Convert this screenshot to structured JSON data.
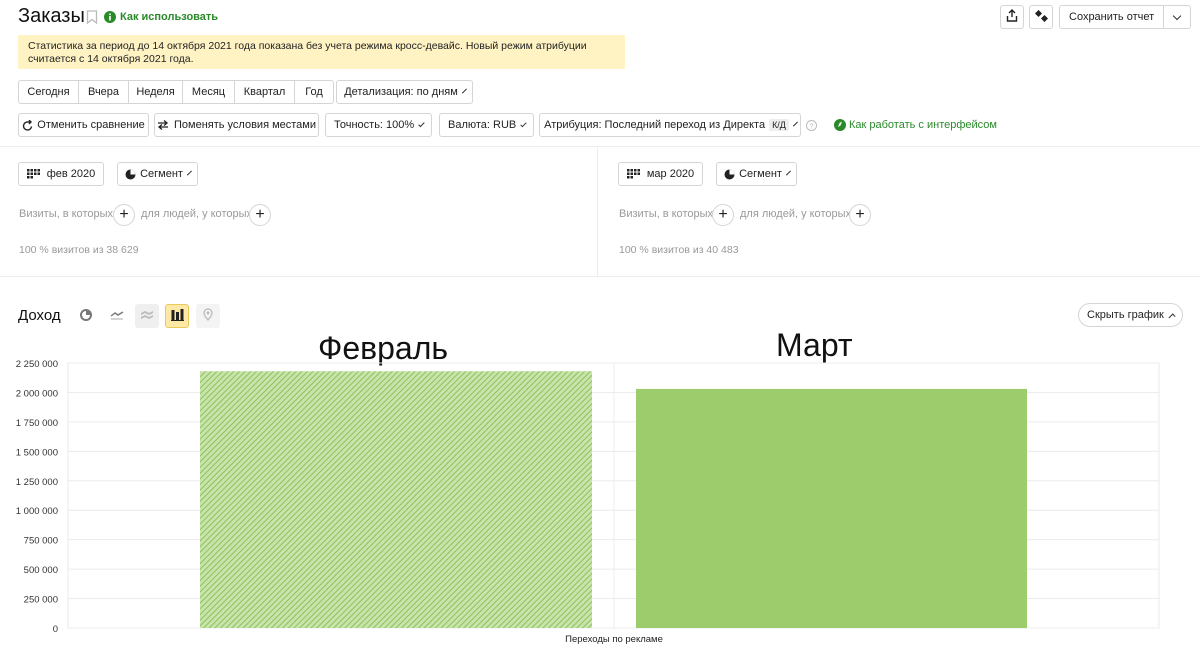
{
  "header": {
    "title": "Заказы",
    "how_to_use": "Как использовать",
    "save_report": "Сохранить отчет"
  },
  "notice": {
    "line1": "Статистика за период до 14 октября 2021 года показана без учета режима кросс-девайс. Новый режим атрибуции",
    "line2": "считается с 14 октября 2021 года."
  },
  "periods": [
    "Сегодня",
    "Вчера",
    "Неделя",
    "Месяц",
    "Квартал",
    "Год"
  ],
  "detail": "Детализация: по дням",
  "toolbar": {
    "cancel_compare": "Отменить сравнение",
    "swap_conditions": "Поменять условия местами",
    "accuracy": "Точность: 100%",
    "currency": "Валюта: RUB",
    "attribution": "Атрибуция: Последний переход из Директа",
    "attribution_badge": "К/Д",
    "how_to_work": "Как работать с интерфейсом"
  },
  "left_segment": {
    "date": "фев 2020",
    "segment": "Сегмент",
    "visits_label": "Визиты, в которых",
    "people_label": "для людей, у которых",
    "summary": "100 % визитов из 38 629"
  },
  "right_segment": {
    "date": "мар 2020",
    "segment": "Сегмент",
    "visits_label": "Визиты, в которых",
    "people_label": "для людей, у которых",
    "summary": "100 % визитов из 40 483"
  },
  "chart_section": {
    "title": "Доход",
    "hide_chart": "Скрыть график"
  },
  "colors": {
    "bar_green": "#9ccc6b",
    "link_green": "#2a8a2a",
    "notice_bg": "#fff3c4",
    "active_icon_bg": "#fde8a6"
  },
  "chart_data": {
    "type": "bar",
    "categories": [
      "Переходы по рекламе"
    ],
    "series": [
      {
        "name": "Февраль",
        "values": [
          2180000
        ],
        "pattern": "hatched"
      },
      {
        "name": "Март",
        "values": [
          2030000
        ],
        "pattern": "solid"
      }
    ],
    "xlabel": "Переходы по рекламе",
    "ylim": [
      0,
      2250000
    ],
    "yticks": [
      "0",
      "250 000",
      "500 000",
      "750 000",
      "1 000 000",
      "1 250 000",
      "1 500 000",
      "1 750 000",
      "2 000 000",
      "2 250 000"
    ],
    "ytick_values": [
      0,
      250000,
      500000,
      750000,
      1000000,
      1250000,
      1500000,
      1750000,
      2000000,
      2250000
    ],
    "grid": true
  }
}
